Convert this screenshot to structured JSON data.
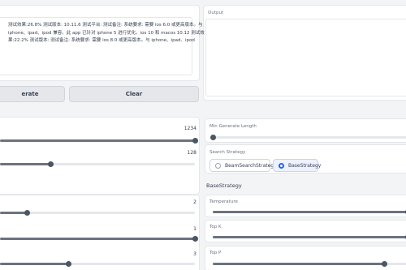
{
  "buttons": {
    "generate": "erate",
    "clear": "Clear"
  },
  "output": {
    "label": "Output",
    "text": "测试效果:26.8% 测试版本: 10.11.6 测试平台: 测试备注: 系统要求: 需要 ios 6.0 或更高版本。与 iphone、ipad、ipod 兼容。此 app 已针对 iphone 5 进行优化。ios 10 和 macos 10.12 测试效果:22.2% 测试版本: 测试备注: 系统要求: 需要 ios 8.0 或更高版本。与 iphone、ipad、ipod"
  },
  "left_sliders": [
    {
      "value": "1234",
      "fraction": 1.0
    },
    {
      "value": "128",
      "fraction": 0.26
    },
    {
      "value": "2",
      "fraction": 0.14
    },
    {
      "value": "1",
      "fraction": 1.0
    },
    {
      "value": "3",
      "fraction": 0.35
    }
  ],
  "right": {
    "min_length_label": "Min Generate Length",
    "min_length_fraction": 0.0,
    "search_label": "Search Strategy",
    "options": [
      "BeamSearchStrategy",
      "BaseStrategy"
    ],
    "selected": "BaseStrategy",
    "section_title": "BaseStrategy",
    "temperature_label": "Temperature",
    "temperature_fraction": 1.0,
    "topk_label": "Top K",
    "topk_fraction": 1.0,
    "topp_label": "Top P",
    "topp_fraction": 0.88
  },
  "colors": {
    "accent": "#2563eb",
    "slider": "#6b7280",
    "panel": "#ffffff",
    "background": "#f3f4f6"
  }
}
